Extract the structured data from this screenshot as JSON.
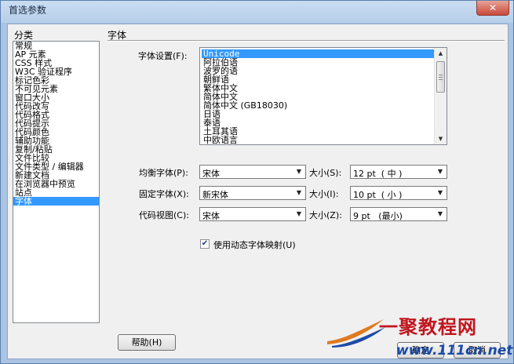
{
  "window": {
    "title": "首选参数",
    "close_glyph": "✕"
  },
  "sidebar": {
    "label": "分类",
    "items": [
      "常规",
      "AP 元素",
      "CSS 样式",
      "W3C 验证程序",
      "标记色彩",
      "不可见元素",
      "窗口大小",
      "代码改写",
      "代码格式",
      "代码提示",
      "代码颜色",
      "辅助功能",
      "复制/粘贴",
      "文件比较",
      "文件类型 / 编辑器",
      "新建文档",
      "在浏览器中预览",
      "站点",
      "字体"
    ],
    "selected_index": 18
  },
  "main": {
    "section_title": "字体",
    "font_setting_label": "字体设置(F):",
    "font_list": [
      "Unicode",
      "阿拉伯语",
      "波罗的语",
      "朝鲜语",
      "繁体中文",
      "简体中文",
      "简体中文 (GB18030)",
      "日语",
      "泰语",
      "土耳其语",
      "中欧语言"
    ],
    "font_list_selected_index": 0,
    "rows": [
      {
        "label": "均衡字体(P):",
        "font": "宋体",
        "size_label": "大小(S):",
        "size": "12 pt  ( 中 )"
      },
      {
        "label": "固定字体(X):",
        "font": "新宋体",
        "size_label": "大小(I):",
        "size": "10 pt  ( 小 )"
      },
      {
        "label": "代码视图(C):",
        "font": "宋体",
        "size_label": "大小(Z):",
        "size": "9 pt   (最小)"
      }
    ],
    "dynamic_mapping": {
      "label": "使用动态字体映射(U)",
      "checked": true,
      "check_glyph": "✔"
    }
  },
  "buttons": {
    "help": "帮助(H)",
    "ok": "确定",
    "cancel": "取消"
  },
  "watermark": {
    "brand": "一聚教程网",
    "url": "www.111cn.net"
  },
  "icons": {
    "dropdown": "▼",
    "scroll_up": "▲",
    "scroll_down": "▼"
  },
  "colors": {
    "selection": "#3399ff",
    "frame": "#aac4e2",
    "close_button": "#c8493a"
  }
}
